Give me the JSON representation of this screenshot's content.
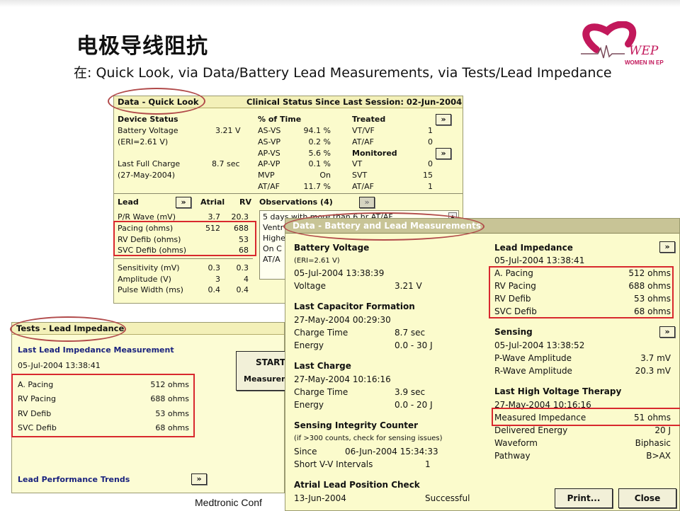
{
  "slide": {
    "title": "电极导线阻抗",
    "subtitle": "在: Quick Look, via Data/Battery Lead Measurements, via Tests/Lead Impedance",
    "logo_text": "WOMEN IN EP",
    "logo_mark": "WEP",
    "footer": "Medtronic Conf"
  },
  "quicklook": {
    "title": "Data - Quick Look",
    "status_title": "Clinical Status Since Last Session: 02-Jun-2004",
    "device_status": "Device Status",
    "battery_voltage_label": "Battery Voltage",
    "battery_voltage_value": "3.21 V",
    "eri": "(ERI=2.61 V)",
    "last_full_charge_label": "Last Full Charge",
    "last_full_charge_value": "8.7 sec",
    "last_full_charge_date": "(27-May-2004)",
    "pct_time_header": "% of Time",
    "pct_rows": [
      {
        "label": "AS-VS",
        "value": "94.1 %"
      },
      {
        "label": "AS-VP",
        "value": "0.2 %"
      },
      {
        "label": "AP-VS",
        "value": "5.6 %"
      },
      {
        "label": "AP-VP",
        "value": "0.1 %"
      },
      {
        "label": "MVP",
        "value": "On"
      },
      {
        "label": "AT/AF",
        "value": "11.7 %"
      }
    ],
    "treated_header": "Treated",
    "treated_rows": [
      {
        "label": "VT/VF",
        "value": "1"
      },
      {
        "label": "AT/AF",
        "value": "0"
      }
    ],
    "monitored_header": "Monitored",
    "monitored_rows": [
      {
        "label": "VT",
        "value": "0"
      },
      {
        "label": "SVT",
        "value": "15"
      },
      {
        "label": "AT/AF",
        "value": "1"
      }
    ],
    "lead_header": "Lead",
    "atrial_header": "Atrial",
    "rv_header": "RV",
    "lead_rows": [
      {
        "label": "P/R Wave (mV)",
        "atrial": "3.7",
        "rv": "20.3"
      },
      {
        "label": "Pacing (ohms)",
        "atrial": "512",
        "rv": "688"
      },
      {
        "label": "RV Defib (ohms)",
        "atrial": "",
        "rv": "53"
      },
      {
        "label": "SVC Defib (ohms)",
        "atrial": "",
        "rv": "68"
      },
      {
        "label": "Sensitivity (mV)",
        "atrial": "0.3",
        "rv": "0.3"
      },
      {
        "label": "Amplitude (V)",
        "atrial": "3",
        "rv": "4"
      },
      {
        "label": "Pulse Width (ms)",
        "atrial": "0.4",
        "rv": "0.4"
      }
    ],
    "observations_header": "Observations (4)",
    "observations": [
      "5 days with more than 6 hr AT/AF",
      "Ventr",
      "Highe",
      "On C",
      "AT/A"
    ]
  },
  "tests": {
    "title": "Tests - Lead Impedance",
    "last_measurement_label": "Last Lead Impedance Measurement",
    "date": "05-Jul-2004 13:38:41",
    "rows": [
      {
        "label": "A. Pacing",
        "value": "512 ohms"
      },
      {
        "label": "RV Pacing",
        "value": "688 ohms"
      },
      {
        "label": "RV Defib",
        "value": "53 ohms"
      },
      {
        "label": "SVC Defib",
        "value": "68 ohms"
      }
    ],
    "start_label": "START",
    "measure_label": "Measurem",
    "trends_label": "Lead Performance Trends"
  },
  "battery": {
    "title": "Data - Battery and Lead Measurements",
    "battery_voltage_header": "Battery Voltage",
    "eri": "(ERI=2.61 V)",
    "bv_date": "05-Jul-2004 13:38:39",
    "voltage_label": "Voltage",
    "voltage_value": "3.21 V",
    "cap_header": "Last Capacitor Formation",
    "cap_date": "27-May-2004 00:29:30",
    "cap_charge_label": "Charge Time",
    "cap_charge_value": "8.7 sec",
    "cap_energy_label": "Energy",
    "cap_energy_value": "0.0 - 30 J",
    "lc_header": "Last Charge",
    "lc_date": "27-May-2004 10:16:16",
    "lc_charge_label": "Charge Time",
    "lc_charge_value": "3.9 sec",
    "lc_energy_label": "Energy",
    "lc_energy_value": "0.0 - 20 J",
    "sic_header": "Sensing Integrity Counter",
    "sic_note": "(if >300 counts, check for sensing issues)",
    "since_label": "Since",
    "since_value": "06-Jun-2004 15:34:33",
    "svv_label": "Short V-V Intervals",
    "svv_value": "1",
    "alp_header": "Atrial Lead Position Check",
    "alp_date": "13-Jun-2004",
    "alp_value": "Successful",
    "li_header": "Lead Impedance",
    "li_date": "05-Jul-2004 13:38:41",
    "li_rows": [
      {
        "label": "A. Pacing",
        "value": "512 ohms"
      },
      {
        "label": "RV Pacing",
        "value": "688 ohms"
      },
      {
        "label": "RV Defib",
        "value": "53 ohms"
      },
      {
        "label": "SVC Defib",
        "value": "68 ohms"
      }
    ],
    "sensing_header": "Sensing",
    "sensing_date": "05-Jul-2004 13:38:52",
    "pwave_label": "P-Wave Amplitude",
    "pwave_value": "3.7 mV",
    "rwave_label": "R-Wave Amplitude",
    "rwave_value": "20.3 mV",
    "hv_header": "Last High Voltage Therapy",
    "hv_date": "27-May-2004 10:16:16",
    "hv_rows": [
      {
        "label": "Measured Impedance",
        "value": "51 ohms"
      },
      {
        "label": "Delivered Energy",
        "value": "20 J"
      },
      {
        "label": "Waveform",
        "value": "Biphasic"
      },
      {
        "label": "Pathway",
        "value": "B>AX"
      }
    ],
    "print_label": "Print...",
    "close_label": "Close"
  },
  "icons": {
    "expand": "double-chevron-right-icon"
  },
  "colors": {
    "panel": "#fbfbcc",
    "highlight": "#d8282e",
    "ellipse": "#b14a4a",
    "link": "#1a237e",
    "logo": "#c2185b"
  }
}
